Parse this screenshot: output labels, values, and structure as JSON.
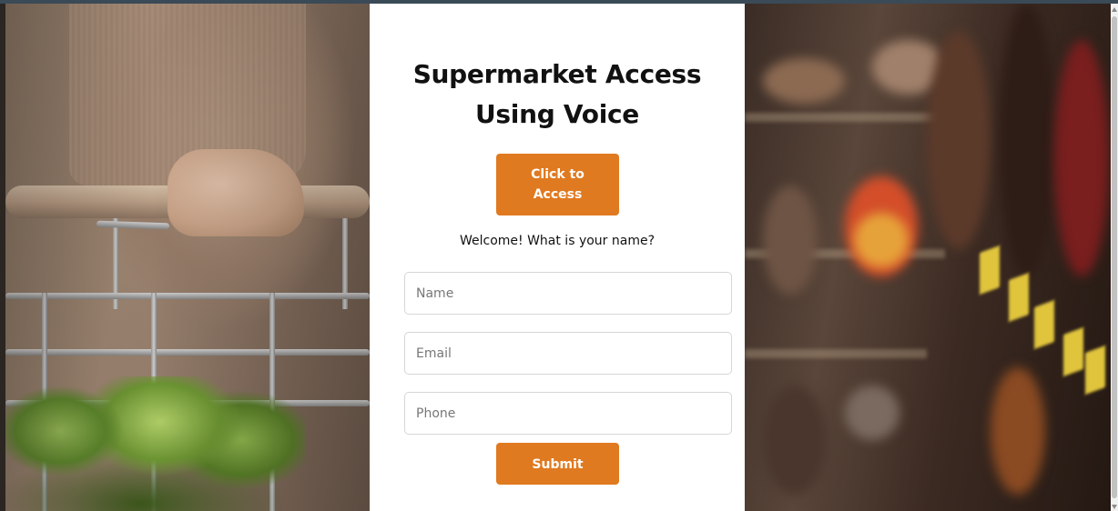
{
  "form": {
    "title_line1": "Supermarket Access",
    "title_line2": "Using Voice",
    "access_button": "Click to Access",
    "prompt": "Welcome! What is your name?",
    "name_placeholder": "Name",
    "email_placeholder": "Email",
    "phone_placeholder": "Phone",
    "submit_button": "Submit"
  },
  "colors": {
    "accent": "#e07a20",
    "card_background": "#ffffff",
    "text": "#111111"
  },
  "icons": {
    "scroll_up": "scroll-up-arrow-icon",
    "scroll_down": "scroll-down-arrow-icon"
  }
}
